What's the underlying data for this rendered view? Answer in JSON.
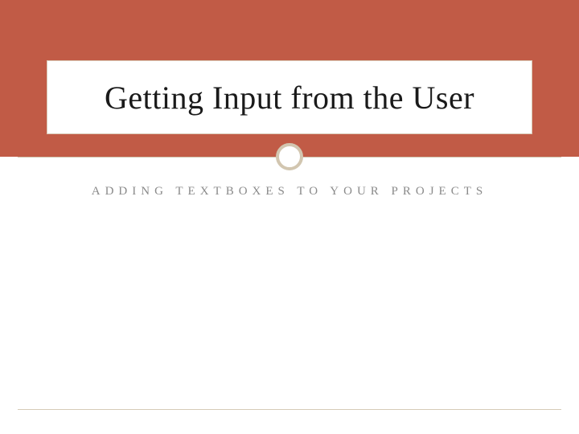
{
  "slide": {
    "title": "Getting Input from the User",
    "subtitle": "ADDING TEXTBOXES TO YOUR PROJECTS"
  },
  "colors": {
    "band": "#c15b46",
    "rule": "#cfc2ad",
    "subtitle": "#8a8a8a"
  }
}
